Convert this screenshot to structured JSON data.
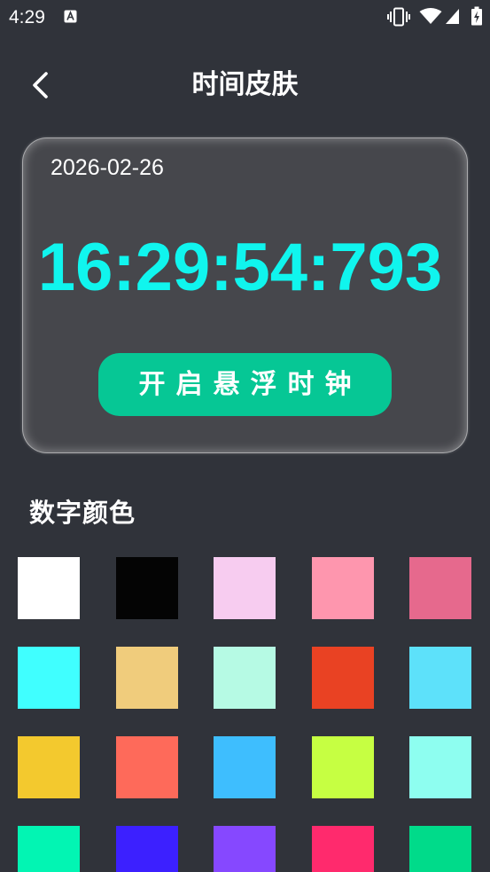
{
  "status_bar": {
    "time": "4:29",
    "icons": [
      "font-a-notification-icon",
      "vibrate-icon",
      "wifi-icon",
      "signal-icon",
      "battery-charging-icon"
    ]
  },
  "header": {
    "back_icon": "chevron-left-icon",
    "title": "时间皮肤"
  },
  "clock_card": {
    "date": "2026-02-26",
    "time": "16:29:54:793",
    "time_color": "#10F5EE",
    "button_label": "开启悬浮时钟",
    "button_color": "#06C795"
  },
  "digit_color_section": {
    "title": "数字颜色",
    "swatches": [
      "#FFFFFF",
      "#040404",
      "#F7CCF0",
      "#FE96AE",
      "#E6698D",
      "#40FFFF",
      "#F0CC7C",
      "#B6FAE4",
      "#E94223",
      "#5DE1FA",
      "#F3C92E",
      "#FE6A5A",
      "#3EBEFE",
      "#C6FF42",
      "#8EFEF0",
      "#02F5B3",
      "#3C20FF",
      "#8648FF",
      "#FF2A6D",
      "#00DB8A"
    ]
  },
  "theme": {
    "background": "#30333A",
    "card_background": "#46474C"
  }
}
